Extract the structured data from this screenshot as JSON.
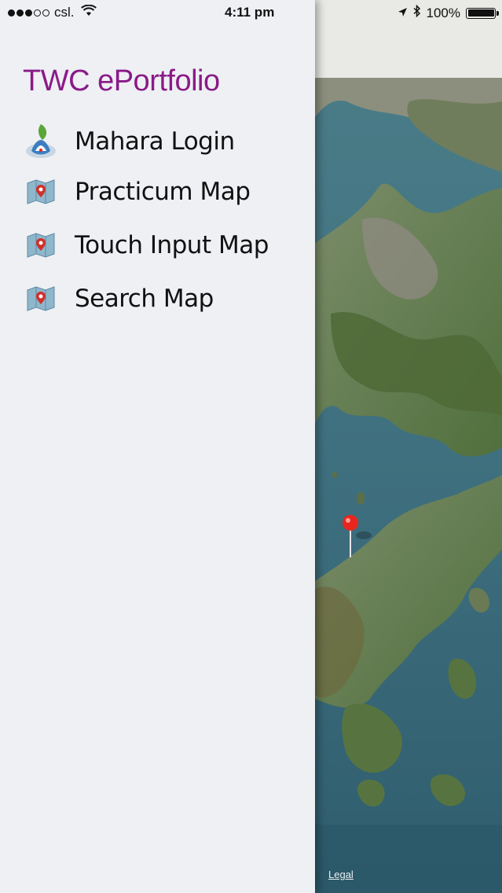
{
  "status_bar": {
    "carrier": "csl.",
    "time": "4:11 pm",
    "battery": "100%",
    "signal_bars_filled": 3,
    "signal_bars_total": 5
  },
  "drawer": {
    "title": "TWC ePortfolio",
    "items": [
      {
        "label": "Mahara Login",
        "icon": "mahara-logo-icon"
      },
      {
        "label": "Practicum Map",
        "icon": "map-pin-icon"
      },
      {
        "label": "Touch Input Map",
        "icon": "map-pin-icon"
      },
      {
        "label": "Search Map",
        "icon": "map-pin-icon"
      }
    ]
  },
  "map": {
    "legal_link": "Legal",
    "pin_color": "#e8261d"
  },
  "colors": {
    "title": "#8a1a88",
    "drawer_bg": "#eef0f4",
    "sea": "#3f6f7d",
    "land": "#5f7a45"
  }
}
